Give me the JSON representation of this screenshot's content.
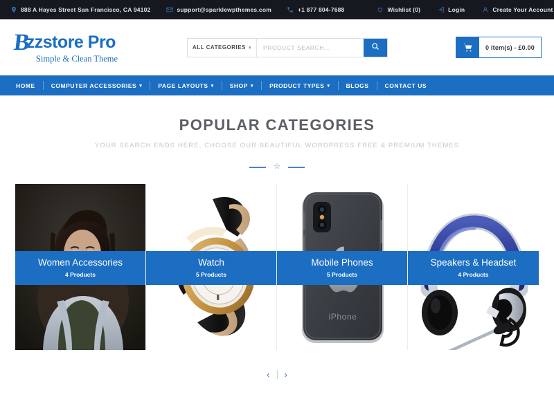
{
  "topbar": {
    "address": "888 A Hayes Street San Francisco, CA 94102",
    "email": "support@sparklewpthemes.com",
    "phone": "+1 877 804-7688",
    "wishlist": "Wishlist (0)",
    "login": "Login",
    "create_account": "Create Your Account",
    "bg_color": "#15181f",
    "icon_color": "#3a6fb0"
  },
  "header": {
    "logo_initial": "B",
    "logo_text": "zzstore Pro",
    "logo_tagline": "Simple & Clean Theme",
    "brand_color": "#1b6ec2",
    "search": {
      "category_label": "ALL CATEGORIES",
      "placeholder": "PRODUCT SEARCH...",
      "value": ""
    },
    "cart": {
      "label": "0 item(s) - £0.00"
    }
  },
  "nav": {
    "items": [
      {
        "label": "HOME",
        "has_dropdown": false
      },
      {
        "label": "COMPUTER ACCESSORIES",
        "has_dropdown": true
      },
      {
        "label": "PAGE LAYOUTS",
        "has_dropdown": true
      },
      {
        "label": "SHOP",
        "has_dropdown": true
      },
      {
        "label": "PRODUCT TYPES",
        "has_dropdown": true
      },
      {
        "label": "BLOGS",
        "has_dropdown": false
      },
      {
        "label": "CONTACT US",
        "has_dropdown": false
      }
    ]
  },
  "section": {
    "title": "POPULAR CATEGORIES",
    "subtitle": "YOUR SEARCH ENDS HERE, CHOOSE OUR BEAUTIFUL WORDPRESS FREE & PREMIUM THEMES",
    "divider_icon": "star-icon"
  },
  "categories": [
    {
      "name": "Women Accessories",
      "count": "4 Products",
      "image": "woman-portrait-denim-jacket"
    },
    {
      "name": "Watch",
      "count": "5 Products",
      "image": "gold-watch-black-leather-strap"
    },
    {
      "name": "Mobile Phones",
      "count": "5 Products",
      "image": "dark-gray-iphone-back"
    },
    {
      "name": "Speakers & Headset",
      "count": "4 Products",
      "image": "blue-headset-with-microphone"
    }
  ],
  "carousel": {
    "prev": "‹",
    "next": "›"
  }
}
